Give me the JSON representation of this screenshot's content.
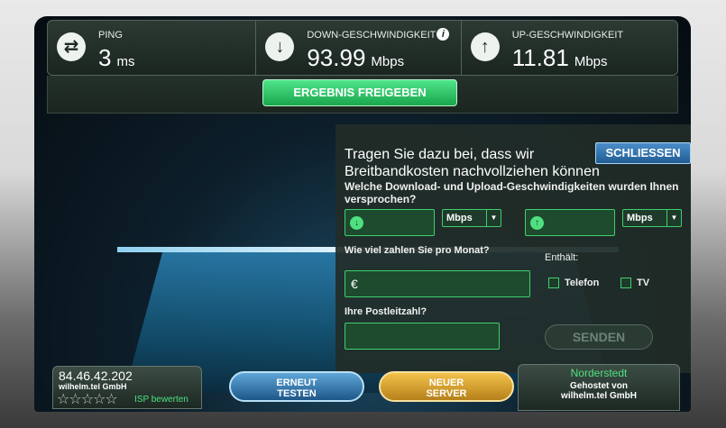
{
  "stats": {
    "ping": {
      "label": "PING",
      "value": "3",
      "unit": "ms",
      "icon": "ping-arrows-icon"
    },
    "download": {
      "label": "DOWN-GESCHWINDIGKEIT",
      "value": "93.99",
      "unit": "Mbps",
      "icon": "download-arrow-icon"
    },
    "upload": {
      "label": "UP-GESCHWINDIGKEIT",
      "value": "11.81",
      "unit": "Mbps",
      "icon": "upload-arrow-icon"
    }
  },
  "share_button": "ERGEBNIS FREIGEBEN",
  "popup": {
    "close_label": "SCHLIESSEN",
    "title": "Tragen Sie dazu bei, dass wir Breitbandkosten nachvollziehen können",
    "question": "Welche Download- und Upload-Geschwindigkeiten wurden Ihnen versprochen?",
    "download_unit": "Mbps",
    "upload_unit": "Mbps",
    "price_question": "Wie viel zahlen Sie pro Monat?",
    "price_currency": "€",
    "includes_label": "Enthält:",
    "phone_label": "Telefon",
    "tv_label": "TV",
    "postcode_question": "Ihre Postleitzahl?",
    "send_label": "SENDEN"
  },
  "footer": {
    "ip": "84.46.42.202",
    "isp": "wilhelm.tel GmbH",
    "stars": "☆☆☆☆☆",
    "rate_isp": "ISP bewerten",
    "retest_line1": "ERNEUT",
    "retest_line2": "TESTEN",
    "newserver_line1": "NEUER",
    "newserver_line2": "SERVER",
    "server_city": "Norderstedt",
    "hosted_by_line1": "Gehostet von",
    "hosted_by_line2": "wilhelm.tel GmbH"
  },
  "colors": {
    "accent_green": "#4ee07f",
    "retest_blue": "#5fa6d8",
    "newserver_gold": "#f2c24a"
  }
}
